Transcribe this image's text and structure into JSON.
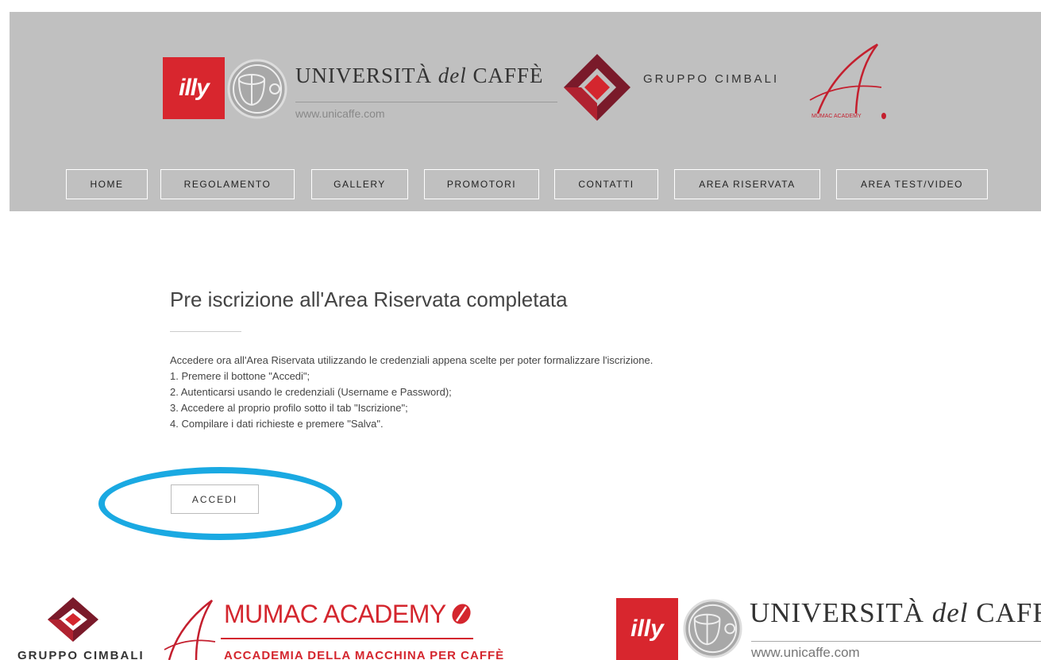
{
  "header": {
    "illy_logo": "illy",
    "university_title_main": "UNIVERSITÀ ",
    "university_title_em": "del",
    "university_title_end": " CAFFÈ",
    "university_url": "www.unicaffe.com",
    "cimbali_name": "GRUPPO CIMBALI",
    "mumac_small_text": "MUMAC ACADEMY"
  },
  "nav": {
    "items": [
      {
        "label": "HOME"
      },
      {
        "label": "REGOLAMENTO"
      },
      {
        "label": "GALLERY"
      },
      {
        "label": "PROMOTORI"
      },
      {
        "label": "CONTATTI"
      },
      {
        "label": "AREA RISERVATA"
      },
      {
        "label": "AREA TEST/VIDEO"
      }
    ]
  },
  "main": {
    "title": "Pre iscrizione all'Area Riservata completata",
    "lines": [
      "Accedere ora all'Area Riservata utilizzando le credenziali appena scelte per poter formalizzare l'iscrizione.",
      "1. Premere il bottone \"Accedi\";",
      "2. Autenticarsi usando le credenziali (Username e Password);",
      "3. Accedere al proprio profilo sotto il tab \"Iscrizione\";",
      "4. Compilare i dati richieste e premere \"Salva\"."
    ],
    "accedi_label": "ACCEDI"
  },
  "footer": {
    "cimbali_name": "GRUPPO CIMBALI",
    "mumac_title": "MUMAC ACADEMY",
    "mumac_subtitle": "ACCADEMIA DELLA MACCHINA PER CAFFÈ",
    "illy_logo": "illy",
    "university_title_main": "UNIVERSITÀ ",
    "university_title_em": "del",
    "university_title_end": " CAFFÈ",
    "university_url": "www.unicaffe.com"
  },
  "colors": {
    "header_bg": "#c0c0c0",
    "illy_red": "#d8262e",
    "highlight_blue": "#1aa9e2",
    "mumac_red": "#d4262e",
    "cimbali_dark": "#7a1a2a"
  },
  "icons": [
    "illy-logo",
    "university-cup-icon",
    "cimbali-diamond-icon",
    "mumac-a-icon",
    "coffee-bean-icon"
  ]
}
